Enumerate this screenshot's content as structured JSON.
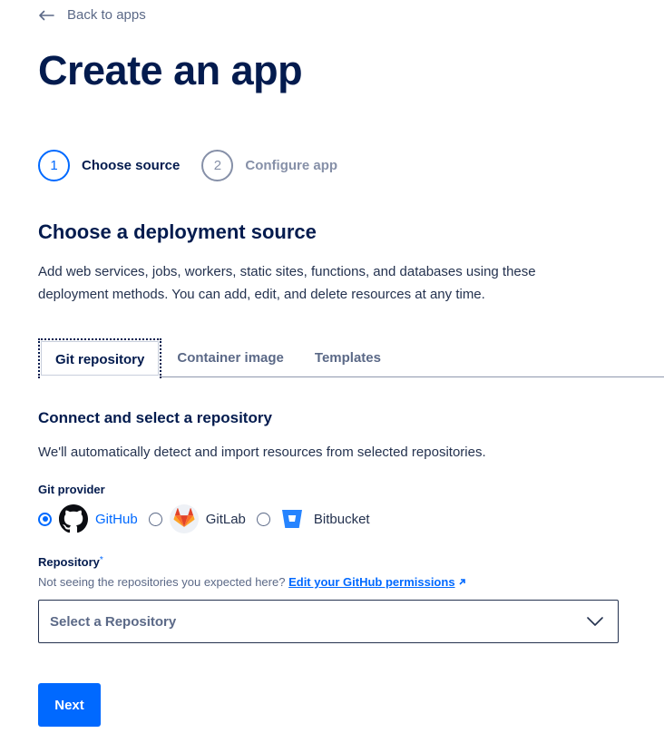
{
  "back_link": {
    "label": "Back to apps",
    "icon": "arrow-left-icon"
  },
  "page": {
    "title": "Create an app"
  },
  "stepper": {
    "steps": [
      {
        "number": "1",
        "label": "Choose source",
        "state": "active"
      },
      {
        "number": "2",
        "label": "Configure app",
        "state": "inactive"
      }
    ]
  },
  "section": {
    "title": "Choose a deployment source",
    "description": "Add web services, jobs, workers, static sites, functions, and databases using these deployment methods. You can add, edit, and delete resources at any time."
  },
  "tabs": [
    {
      "label": "Git repository",
      "active": true
    },
    {
      "label": "Container image",
      "active": false
    },
    {
      "label": "Templates",
      "active": false
    }
  ],
  "connect": {
    "title": "Connect and select a repository",
    "description": "We'll automatically detect and import resources from selected repositories."
  },
  "git_provider": {
    "label": "Git provider",
    "options": [
      {
        "name": "GitHub",
        "icon": "github-icon",
        "selected": true
      },
      {
        "name": "GitLab",
        "icon": "gitlab-icon",
        "selected": false
      },
      {
        "name": "Bitbucket",
        "icon": "bitbucket-icon",
        "selected": false
      }
    ]
  },
  "repository": {
    "label": "Repository",
    "required_mark": "*",
    "hint": "Not seeing the repositories you expected here?",
    "hint_link": "Edit your GitHub permissions",
    "select_placeholder": "Select a Repository"
  },
  "actions": {
    "next_label": "Next"
  },
  "colors": {
    "primary": "#0069ff",
    "text_dark": "#031b4e",
    "text_muted": "#5b6987"
  }
}
